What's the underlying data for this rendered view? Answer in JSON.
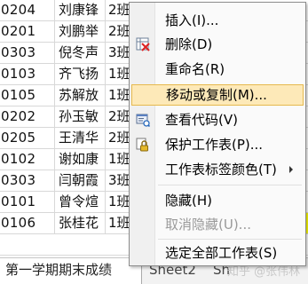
{
  "sheet_rows": [
    {
      "id": "0204",
      "name": "刘康锋",
      "cls": "2班",
      "extra": "…"
    },
    {
      "id": "0201",
      "name": "刘鹏举",
      "cls": "2班",
      "extra": ""
    },
    {
      "id": "0303",
      "name": "倪冬声",
      "cls": "3班",
      "extra": ""
    },
    {
      "id": "0103",
      "name": "齐飞扬",
      "cls": "1班",
      "extra": ""
    },
    {
      "id": "0105",
      "name": "苏解放",
      "cls": "1班",
      "extra": ""
    },
    {
      "id": "0202",
      "name": "孙玉敏",
      "cls": "2班",
      "extra": ""
    },
    {
      "id": "0205",
      "name": "王清华",
      "cls": "2班",
      "extra": ""
    },
    {
      "id": "0102",
      "name": "谢如康",
      "cls": "1班",
      "extra": ""
    },
    {
      "id": "0303",
      "name": "闫朝霞",
      "cls": "3班",
      "extra": ""
    },
    {
      "id": "0101",
      "name": "曾令煊",
      "cls": "1班",
      "extra": ""
    },
    {
      "id": "0106",
      "name": "张桂花",
      "cls": "1班",
      "extra": ""
    }
  ],
  "tabs": {
    "active": "第一学期期末成绩",
    "sheet2": "Sheet2",
    "sheet3": "Sh"
  },
  "watermark": "知乎 @张伟林",
  "context_menu": {
    "insert": "插入(I)...",
    "delete": "删除(D)",
    "rename": "重命名(R)",
    "move_copy": "移动或复制(M)...",
    "view_code": "查看代码(V)",
    "protect_sheet": "保护工作表(P)...",
    "tab_color": "工作表标签颜色(T)",
    "hide": "隐藏(H)",
    "unhide": "取消隐藏(U)...",
    "select_all": "选定全部工作表(S)"
  },
  "colors": {
    "highlight_fill": "#fde9b8",
    "highlight_border": "#e6b94d",
    "yellow_cell": "#ffff00"
  }
}
